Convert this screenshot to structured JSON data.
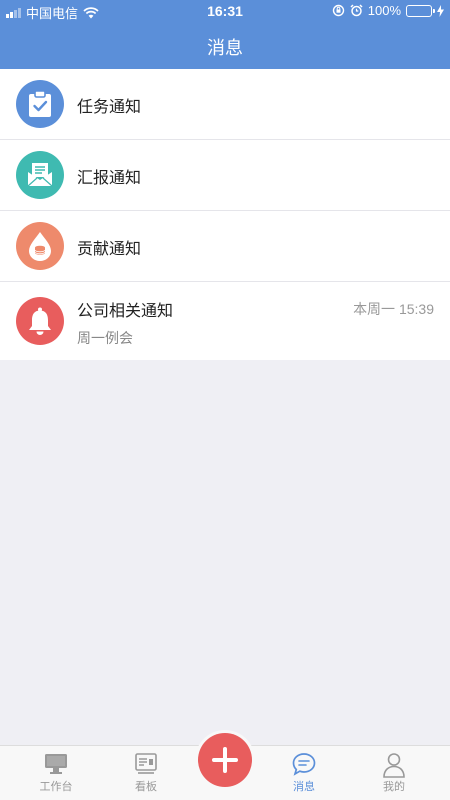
{
  "status_bar": {
    "carrier": "中国电信",
    "time": "16:31",
    "battery": "100%"
  },
  "header": {
    "title": "消息"
  },
  "notifications": [
    {
      "title": "任务通知",
      "icon": "clipboard-check-icon",
      "color": "#5b8fd9"
    },
    {
      "title": "汇报通知",
      "icon": "envelope-icon",
      "color": "#3fbab1"
    },
    {
      "title": "贡献通知",
      "icon": "drop-coins-icon",
      "color": "#ee8a6c"
    },
    {
      "title": "公司相关通知",
      "subtitle": "周一例会",
      "time": "本周一 15:39",
      "icon": "bell-icon",
      "color": "#e85d5d"
    }
  ],
  "tabbar": {
    "workbench": "工作台",
    "board": "看板",
    "messages": "消息",
    "mine": "我的"
  },
  "colors": {
    "primary": "#5b8fd9",
    "fab": "#e85d5d",
    "background": "#efeff4"
  }
}
